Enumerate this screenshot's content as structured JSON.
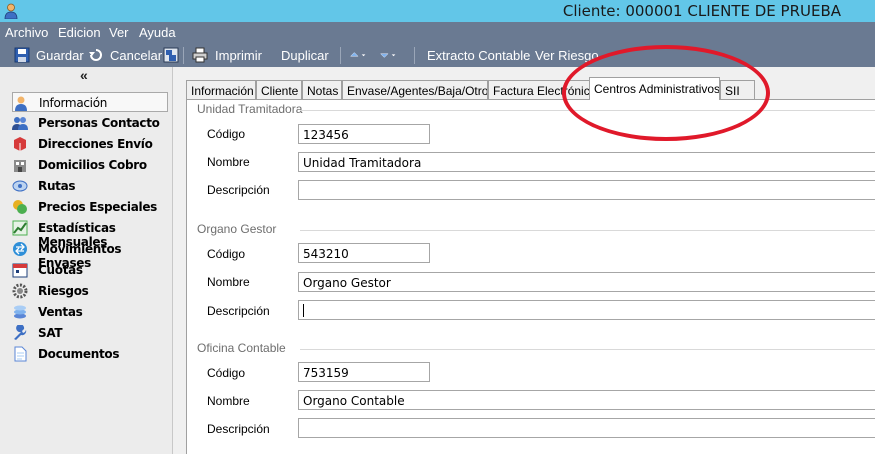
{
  "window": {
    "title": "Cliente: 000001 CLIENTE DE PRUEBA"
  },
  "menu": {
    "archivo": "Archivo",
    "edicion": "Edicion",
    "ver": "Ver",
    "ayuda": "Ayuda"
  },
  "toolbar": {
    "guardar": "Guardar",
    "cancelar": "Cancelar",
    "imprimir": "Imprimir",
    "duplicar": "Duplicar",
    "extracto": "Extracto Contable",
    "riesgo": "Ver Riesgo"
  },
  "nav": {
    "collapse": "«",
    "items": [
      {
        "label": "Información",
        "icon": "user-icon"
      },
      {
        "label": "Personas Contacto",
        "icon": "contacts-icon"
      },
      {
        "label": "Direcciones Envío",
        "icon": "delivery-icon"
      },
      {
        "label": "Domicilios Cobro",
        "icon": "building-icon"
      },
      {
        "label": "Rutas",
        "icon": "route-icon"
      },
      {
        "label": "Precios Especiales",
        "icon": "price-icon"
      },
      {
        "label": "Estadísticas Mensuales",
        "icon": "chart-icon"
      },
      {
        "label": "Movimientos Envases",
        "icon": "transfer-icon"
      },
      {
        "label": "Cuotas",
        "icon": "calendar-icon"
      },
      {
        "label": "Riesgos",
        "icon": "gear-icon"
      },
      {
        "label": "Ventas",
        "icon": "coins-icon"
      },
      {
        "label": "SAT",
        "icon": "wrench-icon"
      },
      {
        "label": "Documentos",
        "icon": "document-icon"
      }
    ]
  },
  "tabs": [
    "Información",
    "Cliente",
    "Notas",
    "Envase/Agentes/Baja/Otros",
    "Factura Electrónica",
    "Centros Administrativos",
    "SII"
  ],
  "active_tab": "Centros Administrativos",
  "sections": {
    "unidad": {
      "title": "Unidad Tramitadora",
      "codigo_label": "Código",
      "codigo": "123456",
      "nombre_label": "Nombre",
      "nombre": "Unidad Tramitadora",
      "descripcion_label": "Descripción",
      "descripcion": ""
    },
    "organo": {
      "title": "Organo Gestor",
      "codigo_label": "Código",
      "codigo": "543210",
      "nombre_label": "Nombre",
      "nombre": "Organo Gestor",
      "descripcion_label": "Descripción",
      "descripcion": ""
    },
    "oficina": {
      "title": "Oficina Contable",
      "codigo_label": "Código",
      "codigo": "753159",
      "nombre_label": "Nombre",
      "nombre": "Organo Contable",
      "descripcion_label": "Descripción",
      "descripcion": ""
    }
  },
  "colors": {
    "titlebar": "#62c6e8",
    "menubar": "#6a7a92",
    "annotation": "#e0192a"
  }
}
